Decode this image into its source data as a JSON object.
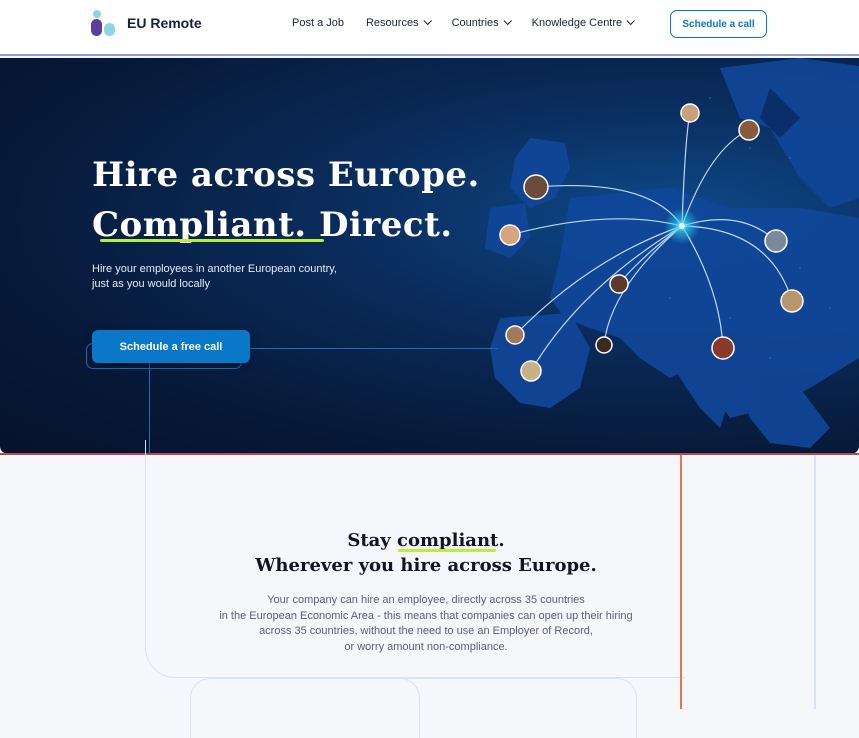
{
  "brand": {
    "name": "EU Remote"
  },
  "nav": {
    "items": [
      {
        "label": "Post a Job",
        "has_dropdown": false
      },
      {
        "label": "Resources",
        "has_dropdown": true
      },
      {
        "label": "Countries",
        "has_dropdown": true
      },
      {
        "label": "Knowledge Centre",
        "has_dropdown": true
      }
    ],
    "cta_label": "Schedule a call"
  },
  "hero": {
    "title_line1": "Hire across Europe.",
    "title_line2": "Compliant. Direct.",
    "subtitle_line1": "Hire your employees in another European country,",
    "subtitle_line2": "just as you would locally",
    "cta_label": "Schedule a free call"
  },
  "section": {
    "title_word1": "Stay ",
    "title_highlight": "compliant",
    "title_end": ".",
    "title_line2": "Wherever you hire across Europe.",
    "body_lines": [
      "Your company can hire an employee, directly across 35 countries",
      "in the European Economic Area - this means that companies can open up their hiring",
      "across 35 countries, without the need to use an Employer of Record,",
      "or worry amount non-compliance."
    ]
  },
  "colors": {
    "accent": "#0a78c9",
    "highlight": "#b7ef3a",
    "hero_bg": "#071a3a",
    "brand_purple": "#5a3fa0",
    "brand_cyan": "#8fd3e8"
  }
}
